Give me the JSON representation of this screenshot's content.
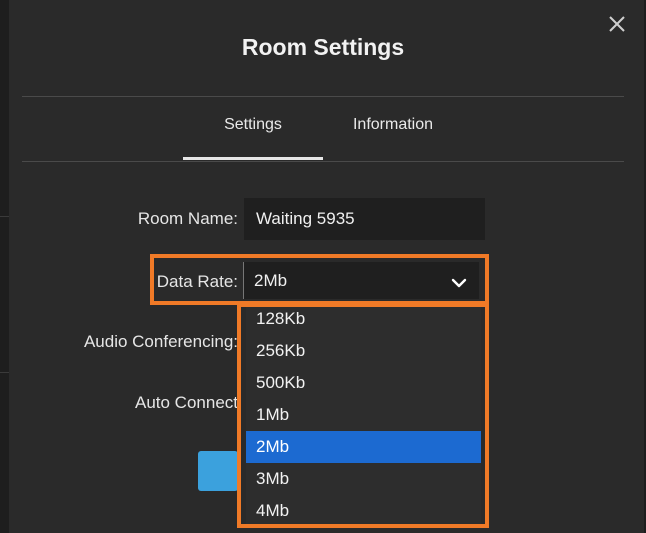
{
  "dialog": {
    "title": "Room Settings"
  },
  "tabs": [
    {
      "label": "Settings",
      "active": true
    },
    {
      "label": "Information",
      "active": false
    }
  ],
  "form": {
    "room_name_label": "Room Name:",
    "room_name_value": "Waiting 5935",
    "data_rate_label": "Data Rate:",
    "data_rate_value": "2Mb",
    "audio_label": "Audio Conferencing:",
    "auto_connect_label": "Auto Connect"
  },
  "dropdown": {
    "options": [
      "128Kb",
      "256Kb",
      "500Kb",
      "1Mb",
      "2Mb",
      "3Mb",
      "4Mb"
    ],
    "selected": "2Mb"
  },
  "colors": {
    "highlight": "#f07a27",
    "selected_option": "#1c6ad1",
    "button": "#3ba1dd"
  },
  "icons": {
    "close": "close-icon",
    "dropdown": "chevron-down-icon"
  }
}
